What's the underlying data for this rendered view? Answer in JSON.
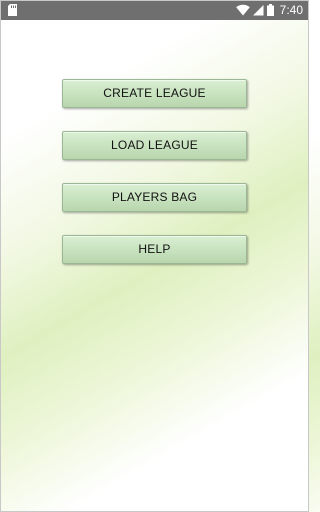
{
  "status_bar": {
    "time": "7:40",
    "icons": [
      "sd-card-icon",
      "wifi-icon",
      "signal-icon",
      "battery-icon"
    ]
  },
  "menu": {
    "create_league": "CREATE LEAGUE",
    "load_league": "LOAD LEAGUE",
    "players_bag": "PLAYERS BAG",
    "help": "HELP"
  },
  "colors": {
    "status_bar": "#6f6f6f",
    "button_fill": "#c7e2be",
    "background_tint": "#dff0c0"
  }
}
